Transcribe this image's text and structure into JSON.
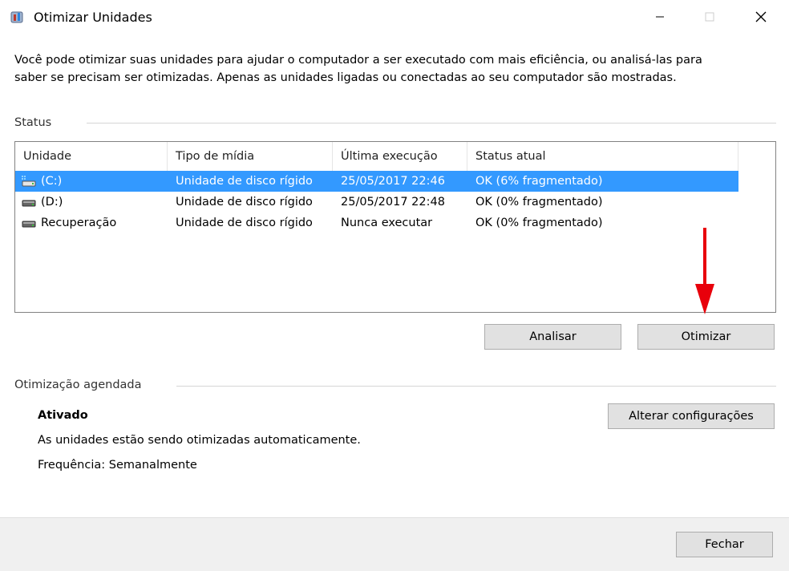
{
  "window": {
    "title": "Otimizar Unidades",
    "intro_text": "Você pode otimizar suas unidades para ajudar o computador a ser executado com mais eficiência, ou analisá-las para saber se precisam ser otimizadas. Apenas as unidades ligadas ou conectadas ao seu computador são mostradas."
  },
  "status": {
    "section_label": "Status",
    "columns": [
      "Unidade",
      "Tipo de mídia",
      "Última execução",
      "Status atual"
    ],
    "rows": [
      {
        "unit": "(C:)",
        "media": "Unidade de disco rígido",
        "last_run": "25/05/2017 22:46",
        "state": "OK (6% fragmentado)",
        "icon": "system-drive-icon",
        "selected": true
      },
      {
        "unit": "(D:)",
        "media": "Unidade de disco rígido",
        "last_run": "25/05/2017 22:48",
        "state": "OK (0% fragmentado)",
        "icon": "drive-icon",
        "selected": false
      },
      {
        "unit": "Recuperação",
        "media": "Unidade de disco rígido",
        "last_run": "Nunca executar",
        "state": "OK (0% fragmentado)",
        "icon": "drive-icon",
        "selected": false
      }
    ]
  },
  "actions": {
    "analyze_label": "Analisar",
    "optimize_label": "Otimizar"
  },
  "scheduled": {
    "section_label": "Otimização agendada",
    "state": "Ativado",
    "description": "As unidades estão sendo otimizadas automaticamente.",
    "frequency": "Frequência: Semanalmente",
    "change_settings_label": "Alterar configurações"
  },
  "footer": {
    "close_label": "Fechar"
  },
  "colors": {
    "selection": "#3399ff",
    "arrow": "#e8000b"
  }
}
